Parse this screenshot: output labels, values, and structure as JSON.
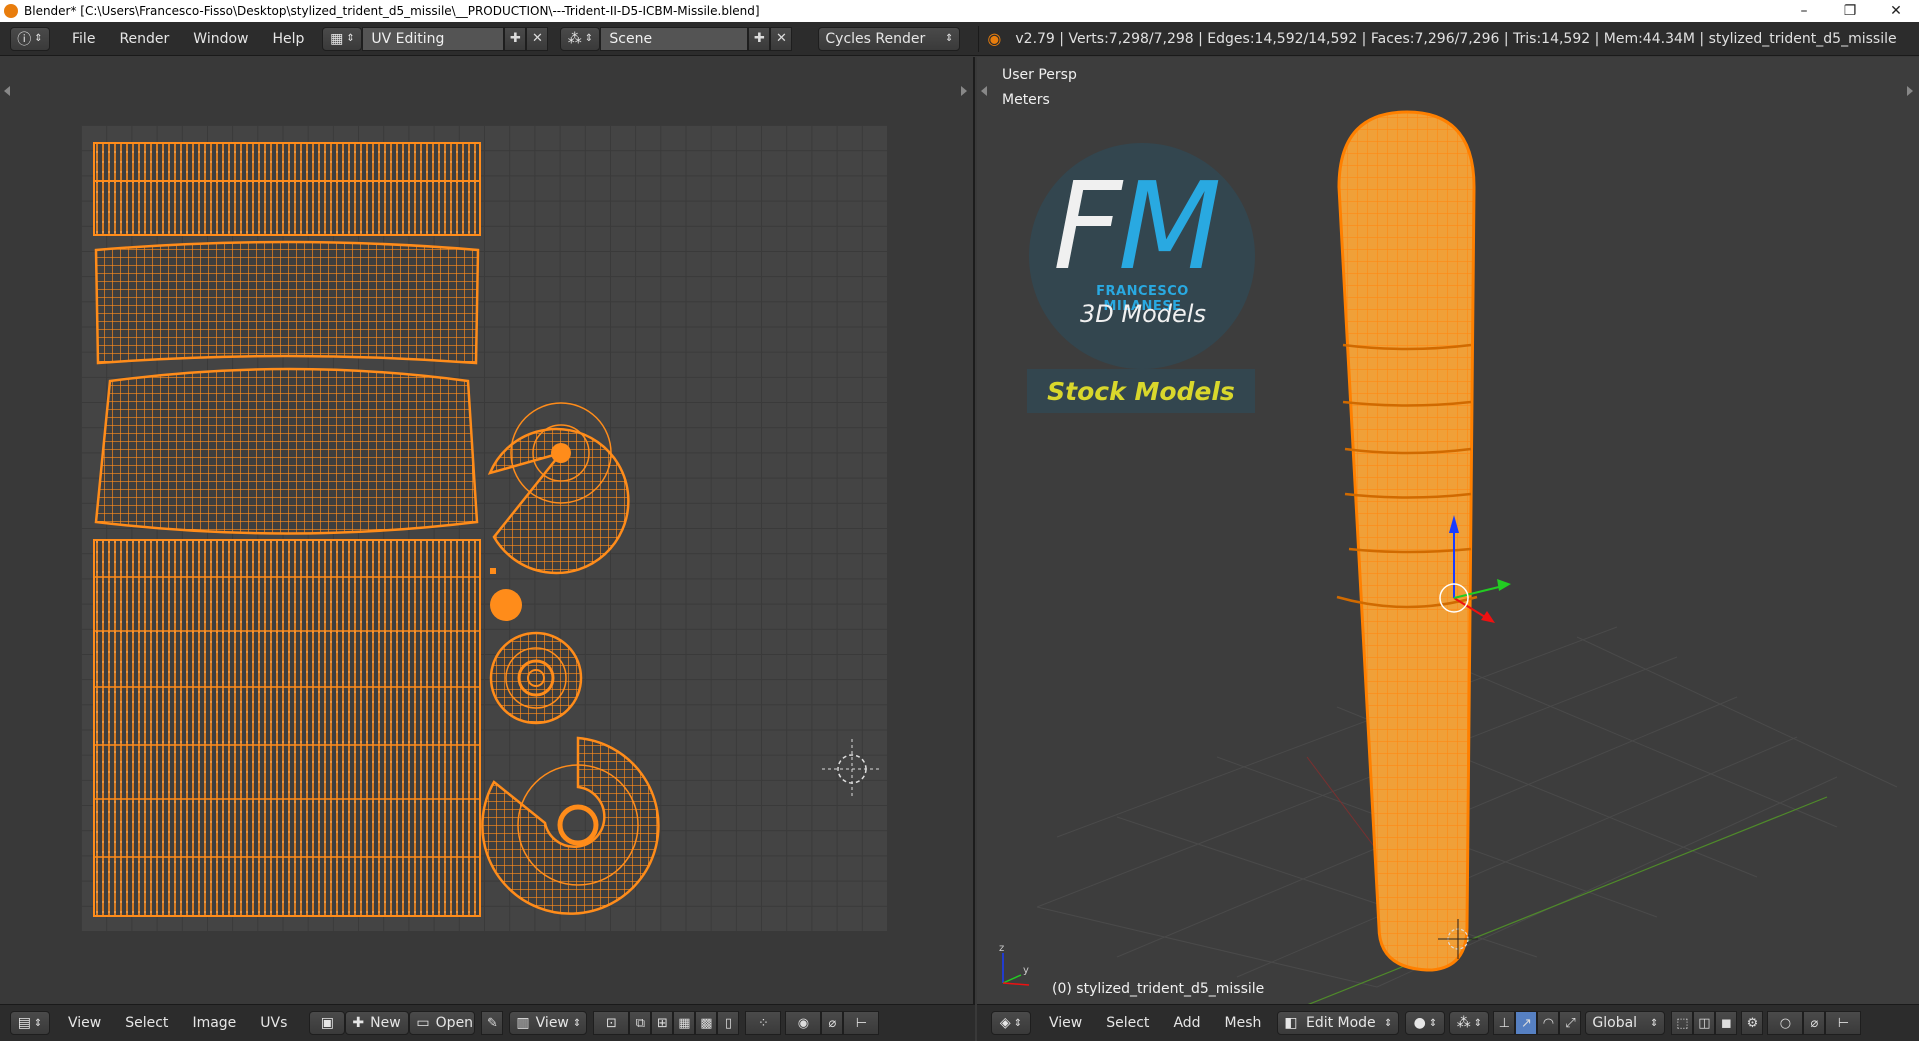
{
  "window": {
    "title": "Blender* [C:\\Users\\Francesco-Fisso\\Desktop\\stylized_trident_d5_missile\\__PRODUCTION\\---Trident-II-D5-ICBM-Missile.blend]",
    "minimize": "–",
    "restore": "❐",
    "close": "✕"
  },
  "topbar": {
    "info_icon": "info-icon",
    "menus": [
      "File",
      "Render",
      "Window",
      "Help"
    ],
    "screen_layout": "UV Editing",
    "scene": "Scene",
    "render_engine": "Cycles Render",
    "stats": "v2.79 | Verts:7,298/7,298 | Edges:14,592/14,592 | Faces:7,296/7,296 | Tris:14,592 | Mem:44.34M | stylized_trident_d5_missile"
  },
  "viewport": {
    "view_name": "User Persp",
    "units": "Meters",
    "object_label": "(0) stylized_trident_d5_missile",
    "logo": {
      "monogram_f": "F",
      "monogram_m": "M",
      "name": "FRANCESCO MILANESE",
      "tagline": "3D Models",
      "banner": "Stock Models"
    }
  },
  "uv_bottom": {
    "menus": [
      "View",
      "Select",
      "Image",
      "UVs"
    ],
    "new_label": "New",
    "open_label": "Open",
    "view_label": "View"
  },
  "view3d_bottom": {
    "menus": [
      "View",
      "Select",
      "Add",
      "Mesh"
    ],
    "mode": "Edit Mode",
    "orientation": "Global"
  },
  "colors": {
    "accent": "#ff8c1a",
    "logo_blue": "#29a9e1",
    "logo_yellow": "#d9d72c"
  }
}
